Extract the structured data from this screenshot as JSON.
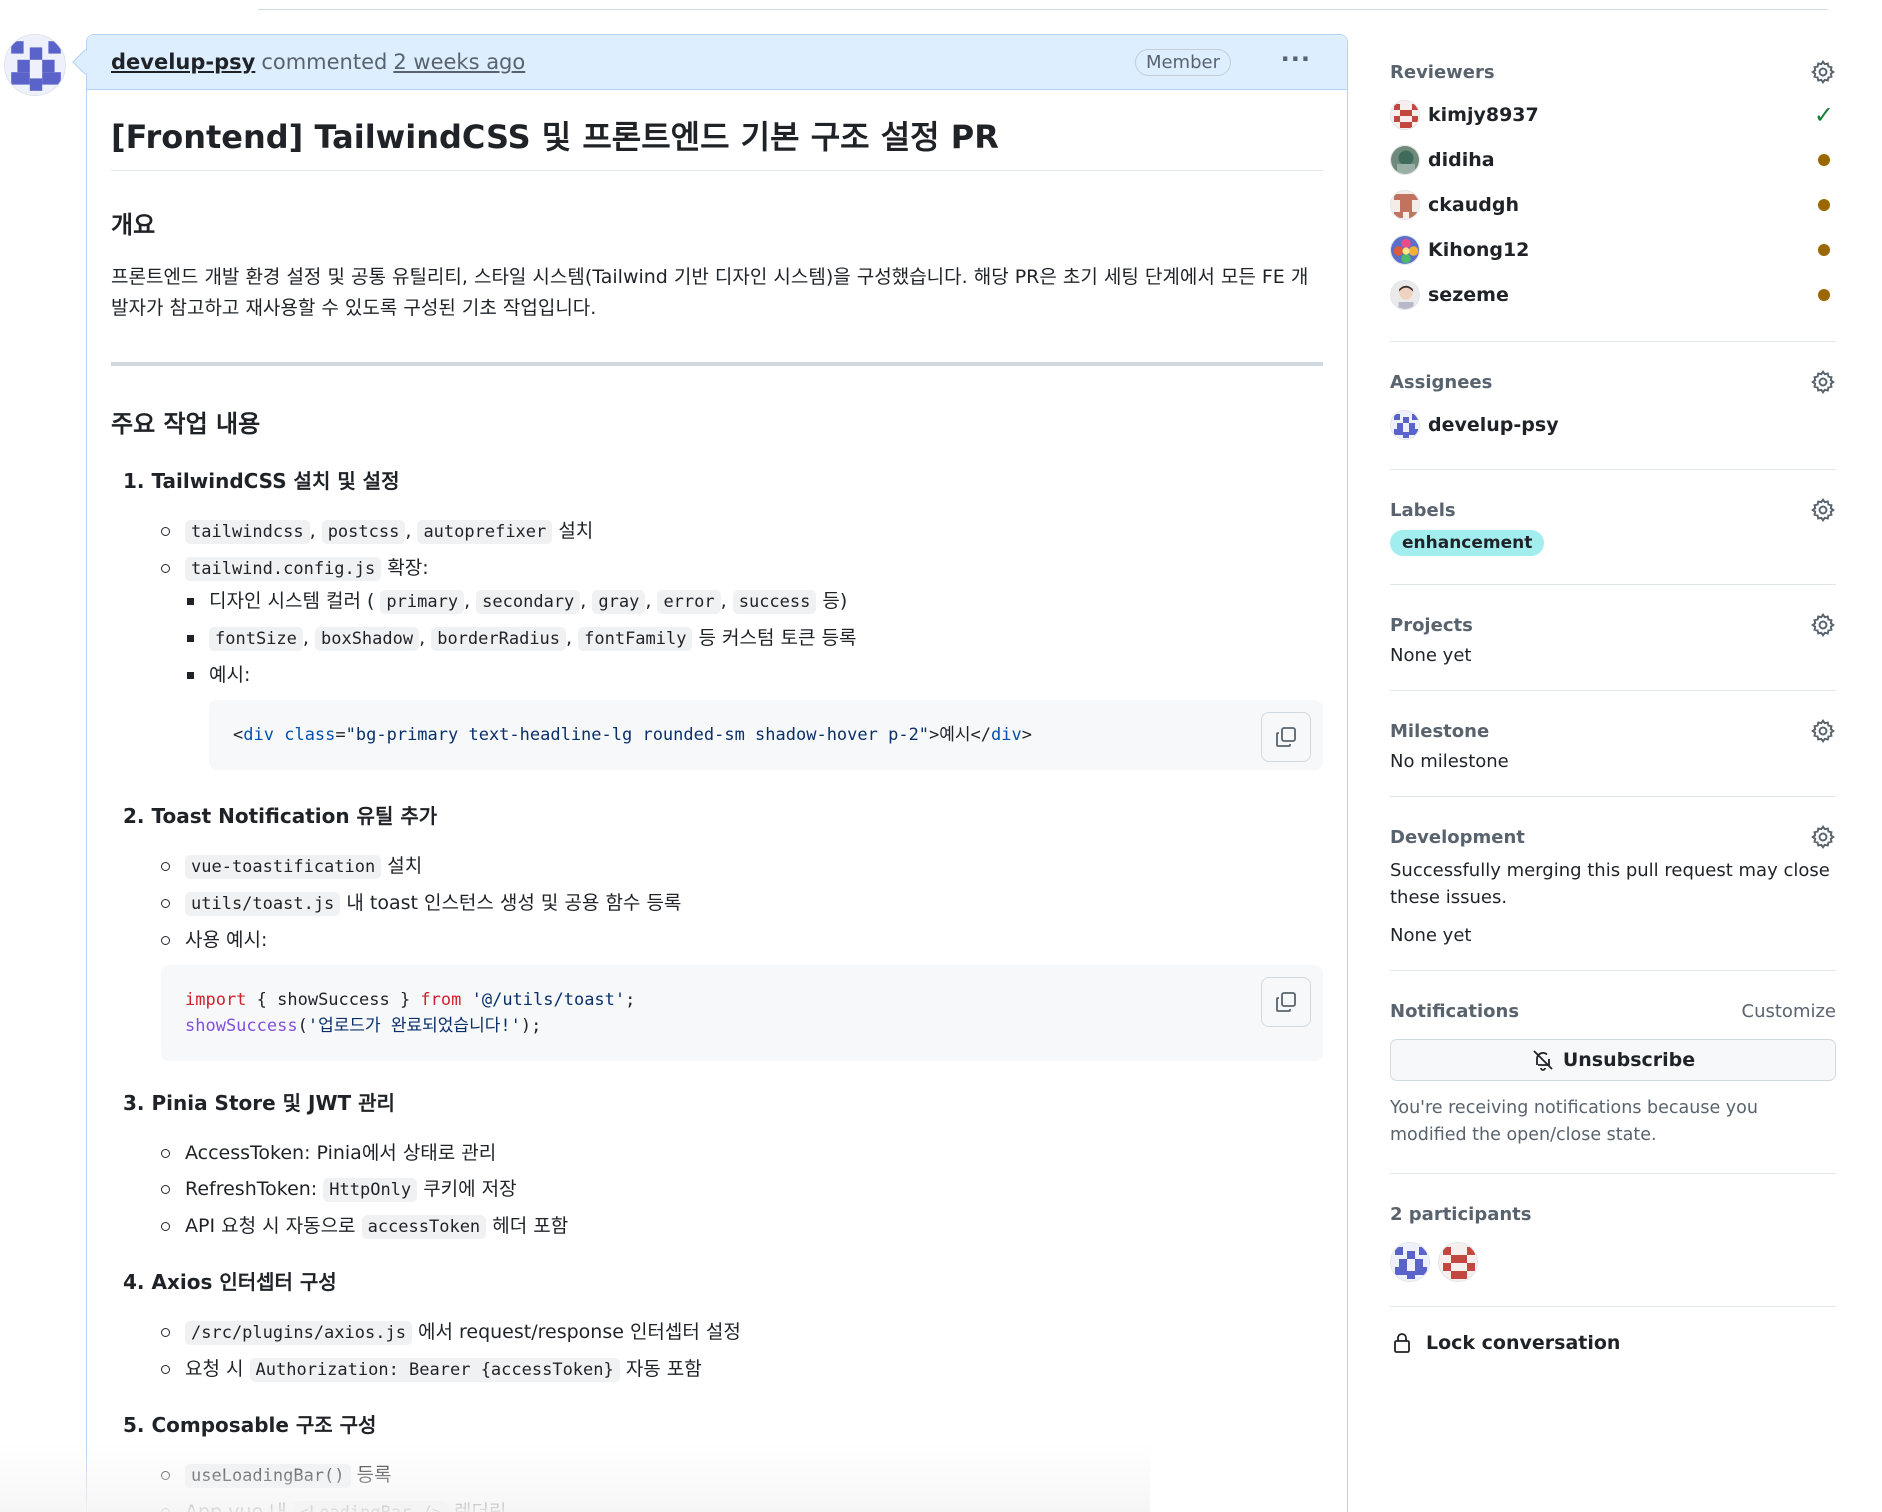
{
  "comment": {
    "author": "develup-psy",
    "action": "commented",
    "time": "2 weeks ago",
    "role_badge": "Member",
    "more_label": "···"
  },
  "body": {
    "title": "[Frontend] TailwindCSS 및 프론트엔드 기본 구조 설정 PR",
    "overview_heading": "개요",
    "overview_text": "프론트엔드 개발 환경 설정 및 공통 유틸리티, 스타일 시스템(Tailwind 기반 디자인 시스템)을 구성했습니다. 해당 PR은 초기 세팅 단계에서 모든 FE 개발자가 참고하고 재사용할 수 있도록 구성된 기초 작업입니다.",
    "main_heading": "주요 작업 내용",
    "s1": {
      "title": "1. TailwindCSS 설치 및 설정",
      "code_a": "tailwindcss",
      "code_b": "postcss",
      "code_c": "autoprefixer",
      "install": "설치",
      "config_code": "tailwind.config.js",
      "extend": "확장:",
      "colors_pre": "디자인 시스템 컬러 (",
      "colors": [
        "primary",
        "secondary",
        "gray",
        "error",
        "success"
      ],
      "colors_post": "등)",
      "tokens": [
        "fontSize",
        "boxShadow",
        "borderRadius",
        "fontFamily"
      ],
      "tokens_post": "등 커스텀 토큰 등록",
      "example": "예시:",
      "snippet": {
        "open": "<",
        "tag": "div",
        "attr": "class",
        "eq": "=",
        "value": "\"bg-primary text-headline-lg rounded-sm shadow-hover p-2\"",
        "text": ">예시</",
        "close_tag": "div",
        "end": ">"
      }
    },
    "s2": {
      "title": "2. Toast Notification 유틸 추가",
      "pkg": "vue-toastification",
      "install": "설치",
      "file": "utils/toast.js",
      "file_desc": "내 toast 인스턴스 생성 및 공용 함수 등록",
      "usage": "사용 예시:",
      "line1_kw": "import",
      "line1_mid": " { showSuccess } ",
      "line1_kw2": "from",
      "line1_str": " '@/utils/toast'",
      "line1_end": ";",
      "line2_fn": "showSuccess",
      "line2_open": "(",
      "line2_str": "'업로드가 완료되었습니다!'",
      "line2_end": ");"
    },
    "s3": {
      "title": "3. Pinia Store 및 JWT 관리",
      "item1": "AccessToken: Pinia에서 상태로 관리",
      "item2_pre": "RefreshToken: ",
      "item2_code": "HttpOnly",
      "item2_post": "쿠키에 저장",
      "item3_pre": "API 요청 시 자동으로 ",
      "item3_code": "accessToken",
      "item3_post": "헤더 포함"
    },
    "s4": {
      "title": "4. Axios 인터셉터 구성",
      "item1_code": "/src/plugins/axios.js",
      "item1_post": "에서 request/response 인터셉터 설정",
      "item2_pre": "요청 시 ",
      "item2_code": "Authorization: Bearer {accessToken}",
      "item2_post": "자동 포함"
    },
    "s5": {
      "title": "5. Composable 구조 구성",
      "item1_code": "useLoadingBar()",
      "item1_post": "등록",
      "item2_pre": "App.vue 내 ",
      "item2_code": "<LoadingBar />",
      "item2_post": "렌더링"
    }
  },
  "sidebar": {
    "reviewers": {
      "heading": "Reviewers",
      "items": [
        {
          "name": "kimjy8937",
          "status": "approved"
        },
        {
          "name": "didiha",
          "status": "pending"
        },
        {
          "name": "ckaudgh",
          "status": "pending"
        },
        {
          "name": "Kihong12",
          "status": "pending"
        },
        {
          "name": "sezeme",
          "status": "pending"
        }
      ]
    },
    "assignees": {
      "heading": "Assignees",
      "name": "develup-psy"
    },
    "labels": {
      "heading": "Labels",
      "label": "enhancement",
      "color": "#a2eeef"
    },
    "projects": {
      "heading": "Projects",
      "value": "None yet"
    },
    "milestone": {
      "heading": "Milestone",
      "value": "No milestone"
    },
    "development": {
      "heading": "Development",
      "text": "Successfully merging this pull request may close these issues.",
      "value": "None yet"
    },
    "notifications": {
      "heading": "Notifications",
      "customize": "Customize",
      "button": "Unsubscribe",
      "reason": "You're receiving notifications because you modified the open/close state."
    },
    "participants": {
      "heading": "2 participants"
    },
    "lock": {
      "label": "Lock conversation"
    }
  },
  "colors": {
    "pending_dot": "#9a6700",
    "approved_check": "#1a7f37",
    "header_bg": "#ddeeff",
    "header_border": "#b6d2f2"
  }
}
